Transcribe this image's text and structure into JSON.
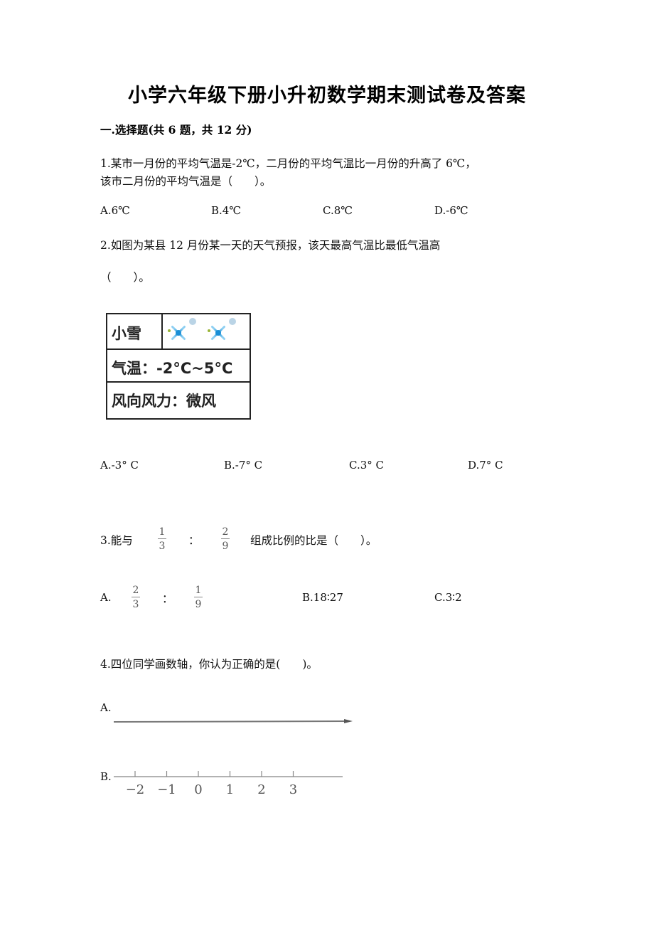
{
  "title": "小学六年级下册小升初数学期末测试卷及答案",
  "section": {
    "heading": "一.选择题(共 6 题，共 12 分)"
  },
  "questions": [
    {
      "line1": "1.某市一月份的平均气温是-2℃，二月份的平均气温比一月份的升高了 6℃，",
      "line2": "该市二月份的平均气温是（　　）。",
      "options": [
        "A.6℃",
        "B.4℃",
        "C.8℃",
        "D.-6℃"
      ]
    },
    {
      "line1": "2.如图为某县 12 月份某一天的天气预报，该天最高气温比最低气温高",
      "line2": "（　　）。",
      "weather_card": {
        "condition": "小雪",
        "condition_icon": "snowflake-icon",
        "temperature": "气温：-2°C~5°C",
        "wind": "风向风力：微风"
      },
      "options": [
        "A.-3° C",
        "B.-7° C",
        "C.3° C",
        "D.7° C"
      ]
    },
    {
      "prefix": "3.能与",
      "fraction1": {
        "num": "1",
        "den": "3"
      },
      "colon": "：",
      "fraction2": {
        "num": "2",
        "den": "9"
      },
      "suffix": "组成比例的比是（　　）。",
      "options": {
        "a_label": "A.",
        "a_fraction1": {
          "num": "2",
          "den": "3"
        },
        "a_colon": "：",
        "a_fraction2": {
          "num": "1",
          "den": "9"
        },
        "b": "B.18∶27",
        "c": "C.3∶2"
      }
    },
    {
      "line1": "4.四位同学画数轴，你认为正确的是(　　)。",
      "option_a_label": "A.",
      "option_b_label": "B.",
      "option_b_ticks": [
        "−2",
        "−1",
        "0",
        "1",
        "2",
        "3"
      ]
    }
  ]
}
